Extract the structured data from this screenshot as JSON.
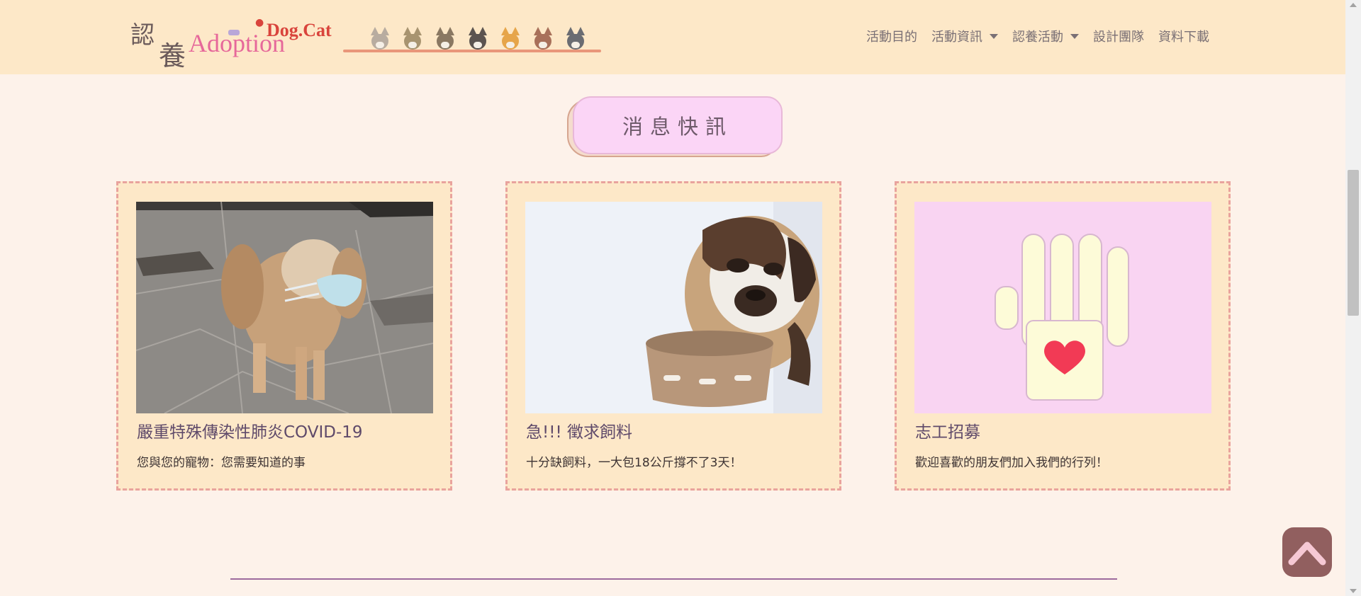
{
  "header": {
    "logo": {
      "kanji_top": "認",
      "kanji_bottom": "養",
      "word_adoption": "Adoption",
      "word_dogcat": "Dog.Cat"
    },
    "pets": [
      {
        "name": "cat-gray-icon",
        "color": "#b8aca0"
      },
      {
        "name": "cat-tan-icon",
        "color": "#a89470"
      },
      {
        "name": "dog-brown-icon",
        "color": "#8a7862"
      },
      {
        "name": "dog-dark-icon",
        "color": "#5c5450"
      },
      {
        "name": "dog-shiba-icon",
        "color": "#e6a54a"
      },
      {
        "name": "dog-red-icon",
        "color": "#a8705a"
      },
      {
        "name": "cat-slate-icon",
        "color": "#6a6c72"
      }
    ]
  },
  "nav": {
    "items": [
      {
        "label": "活動目的",
        "dropdown": false
      },
      {
        "label": "活動資訊",
        "dropdown": true
      },
      {
        "label": "認養活動",
        "dropdown": true
      },
      {
        "label": "設計團隊",
        "dropdown": false
      },
      {
        "label": "資料下載",
        "dropdown": false
      }
    ]
  },
  "section": {
    "title": "消息快訊"
  },
  "cards": [
    {
      "title": "嚴重特殊傳染性肺炎COVID-19",
      "desc": "您與您的寵物：您需要知道的事",
      "image": "dog-wearing-mask-photo"
    },
    {
      "title": "急!!! 徵求飼料",
      "desc": "十分缺飼料，一大包18公斤撐不了3天！",
      "image": "bulldog-food-bowl-photo"
    },
    {
      "title": "志工招募",
      "desc": "歡迎喜歡的朋友們加入我們的行列！",
      "image": "volunteer-hand-heart-icon"
    }
  ],
  "colors": {
    "header_bg": "#fde8c8",
    "page_bg": "#fdf2ea",
    "card_border": "#e9a39d",
    "title_pill": "#fbd5f6",
    "back_to_top": "#915f5f"
  }
}
